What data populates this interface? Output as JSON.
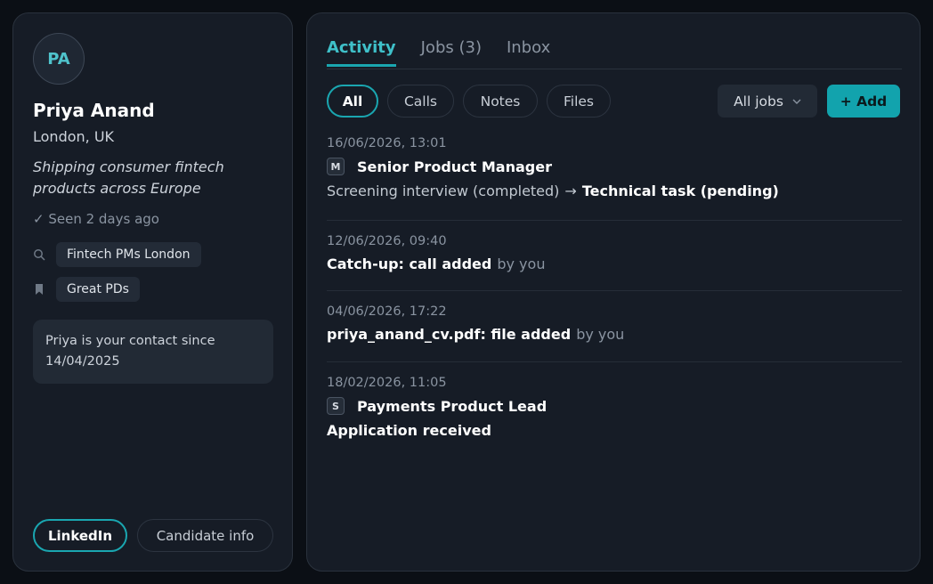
{
  "profile": {
    "initials": "PA",
    "name": "Priya Anand",
    "location": "London, UK",
    "bio": "Shipping consumer fintech products across Europe",
    "seen": "✓ Seen 2 days ago",
    "tags": [
      {
        "icon": "search-icon",
        "label": "Fintech PMs London"
      },
      {
        "icon": "bookmark-icon",
        "label": "Great PDs"
      }
    ],
    "contact_note": "Priya is your contact since 14/04/2025",
    "buttons": {
      "linkedin": "LinkedIn",
      "candidate_info": "Candidate info"
    }
  },
  "tabs": [
    {
      "label": "Activity",
      "active": true
    },
    {
      "label": "Jobs (3)",
      "active": false
    },
    {
      "label": "Inbox",
      "active": false
    }
  ],
  "filters": [
    {
      "label": "All",
      "active": true
    },
    {
      "label": "Calls",
      "active": false
    },
    {
      "label": "Notes",
      "active": false
    },
    {
      "label": "Files",
      "active": false
    }
  ],
  "job_select": {
    "value": "All jobs",
    "icon": "chevron-down-icon"
  },
  "add_button": "+ Add",
  "activities": [
    {
      "timestamp": "16/06/2026, 13:01",
      "badge": "M",
      "title": "Senior Product Manager",
      "detail_from": "Screening interview (completed)",
      "arrow": "→",
      "detail_to": "Technical task (pending)"
    },
    {
      "timestamp": "12/06/2026, 09:40",
      "title": "Catch-up: call added",
      "by": "by you"
    },
    {
      "timestamp": "04/06/2026, 17:22",
      "title": "priya_anand_cv.pdf: file added",
      "by": "by you"
    },
    {
      "timestamp": "18/02/2026, 11:05",
      "badge": "S",
      "title": "Payments Product Lead",
      "detail": "Application received"
    }
  ],
  "colors": {
    "accent": "#1aa6b0",
    "accent_text": "#3fc0c9",
    "panel": "#161c26",
    "background": "#0b0f15"
  }
}
